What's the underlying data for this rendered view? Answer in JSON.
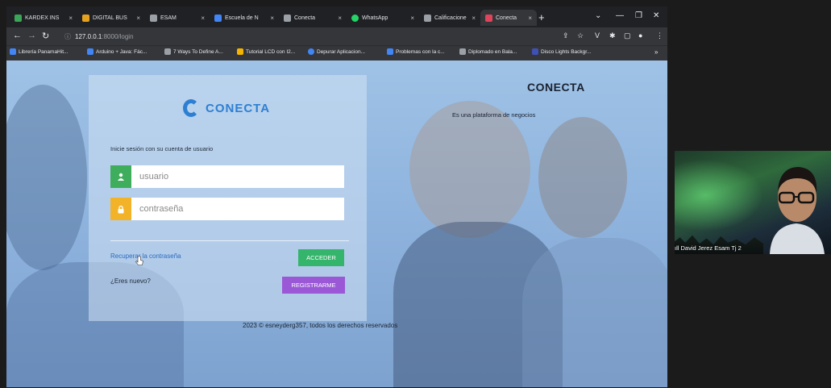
{
  "browser": {
    "tabs": [
      {
        "label": "KARDEX INS",
        "color": "#3aa657"
      },
      {
        "label": "DIGITAL BUS",
        "color": "#e6a21f"
      },
      {
        "label": "ESAM",
        "color": "#9aa0a6"
      },
      {
        "label": "Escuela de N",
        "color": "#4285f4"
      },
      {
        "label": "Conecta",
        "color": "#9aa0a6"
      },
      {
        "label": "WhatsApp",
        "color": "#25d366"
      },
      {
        "label": "Calificacione",
        "color": "#9aa0a6"
      },
      {
        "label": "Conecta",
        "color": "#e0445a",
        "active": true
      }
    ],
    "url_host": "127.0.0.1",
    "url_path": ":8000/login",
    "bookmarks": [
      {
        "label": "Librería PanamaHit...",
        "color": "#4285f4"
      },
      {
        "label": "Arduino + Java: Fác...",
        "color": "#4285f4"
      },
      {
        "label": "7 Ways To Define A...",
        "color": "#9aa0a6"
      },
      {
        "label": "Tutorial LCD con I2...",
        "color": "#f4b400"
      },
      {
        "label": "Depurar Aplicacion...",
        "color": "#4285f4"
      },
      {
        "label": "Problemas con la c...",
        "color": "#4285f4"
      },
      {
        "label": "Diplomado en Bala...",
        "color": "#9aa0a6"
      },
      {
        "label": "Disco Lights Backgr...",
        "color": "#3f51b5"
      }
    ]
  },
  "login": {
    "logo_text": "CONECTA",
    "logo_sub": "",
    "prompt": "Inicie sesión con su cuenta de usuario",
    "username_placeholder": "usuario",
    "password_placeholder": "contraseña",
    "recover_link": "Recuperar la contraseña",
    "acceder_button": "ACCEDER",
    "new_question": "¿Eres nuevo?",
    "register_button": "REGISTRARME"
  },
  "brand": {
    "title": "CONECTA",
    "subtitle": "Es una plataforma de negocios"
  },
  "footer": "2023 © esneyderg357, todos los derechos reservados",
  "video_call": {
    "participant": "David Jerez Esam Tj 2"
  },
  "colors": {
    "acceder": "#35b56b",
    "register": "#9a58d6",
    "user_icon_bg": "#3fae5c",
    "lock_icon_bg": "#f2b329",
    "brand_blue": "#2d7fd3"
  }
}
